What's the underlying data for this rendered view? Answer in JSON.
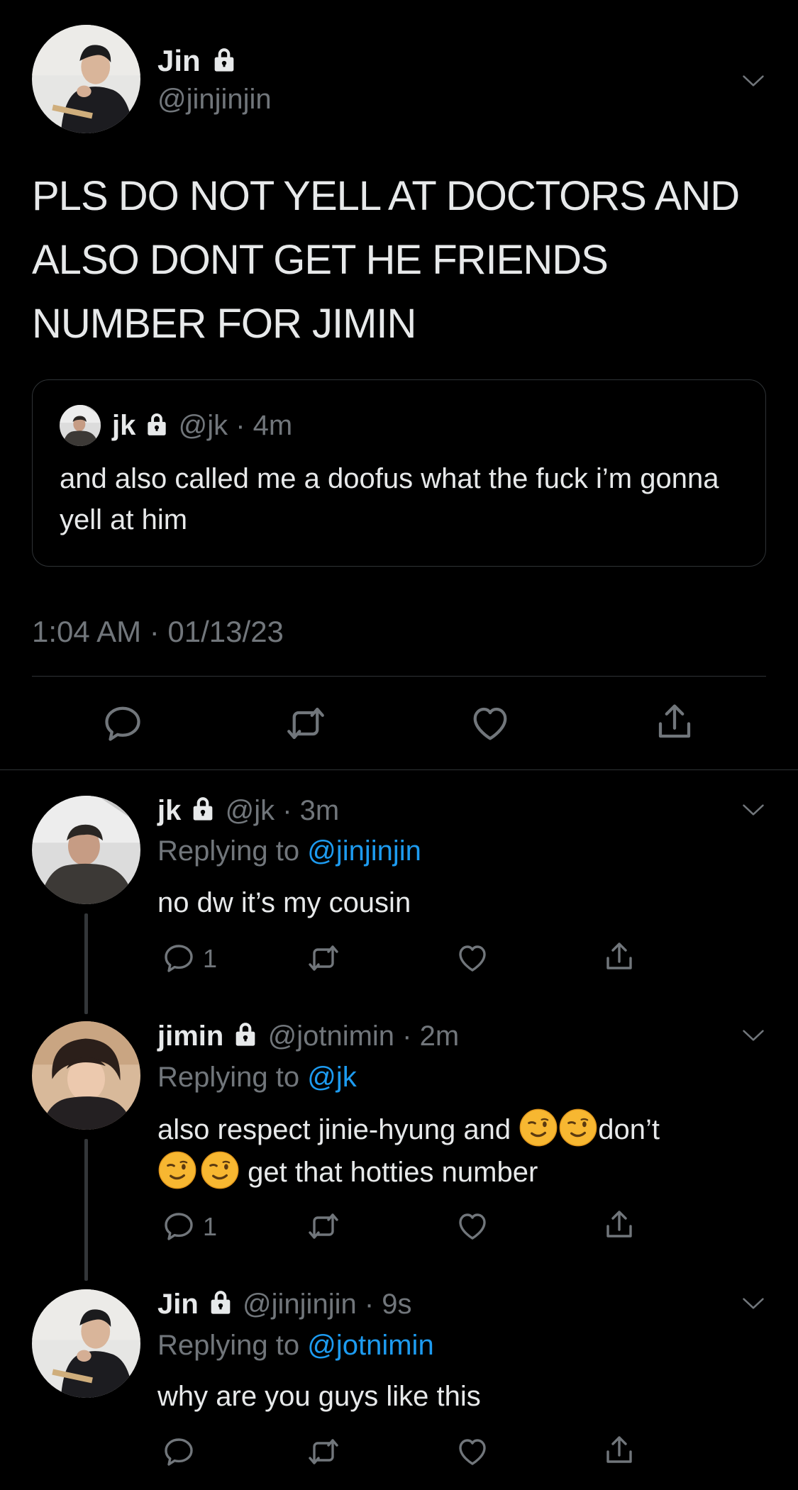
{
  "main_tweet": {
    "name": "Jin",
    "handle": "@jinjinjin",
    "text": "PLS DO NOT YELL AT DOCTORS AND ALSO DONT GET HE FRIENDS NUMBER FOR JIMIN",
    "timestamp": "1:04 AM · 01/13/23",
    "quote": {
      "name": "jk",
      "handle": "@jk",
      "time": "· 4m",
      "text": "and also called me a doofus what the fuck i’m gonna yell at him"
    }
  },
  "replies": [
    {
      "name": "jk",
      "handle": "@jk",
      "time": "· 3m",
      "replying_prefix": "Replying to",
      "replying_to": "@jinjinjin",
      "text": "no dw it’s my cousin",
      "reply_count": "1"
    },
    {
      "name": "jimin",
      "handle": "@jotnimin",
      "time": "· 2m",
      "replying_prefix": "Replying to",
      "replying_to": "@jk",
      "text_part1": "also respect jinie-hyung and",
      "text_part2": "don’t",
      "text_part3": "get that hotties number",
      "reply_count": "1"
    },
    {
      "name": "Jin",
      "handle": "@jinjinjin",
      "time": "· 9s",
      "replying_prefix": "Replying to",
      "replying_to": "@jotnimin",
      "text": "why are you guys like this",
      "reply_count": ""
    }
  ],
  "colors": {
    "background": "#000000",
    "text": "#e7e9ea",
    "secondary": "#71767b",
    "link": "#1d9bf0",
    "divider": "#2f3336"
  },
  "icons": [
    "lock-icon",
    "chevron-down-icon",
    "reply-icon",
    "retweet-icon",
    "like-icon",
    "share-icon",
    "wink-emoji"
  ]
}
